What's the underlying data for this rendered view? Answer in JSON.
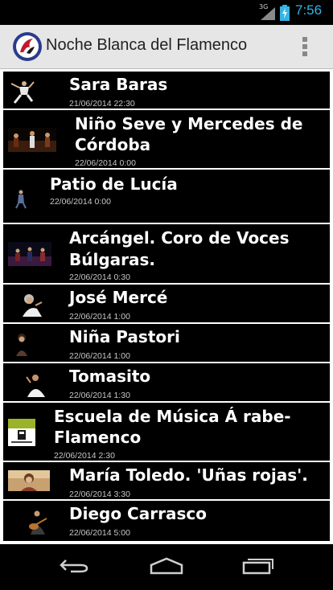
{
  "status_bar": {
    "network": "3G",
    "time": "7:56"
  },
  "action_bar": {
    "title": "Noche Blanca del Flamenco",
    "icon": "app-logo-icon",
    "menu_icon": "overflow-menu-icon"
  },
  "events": [
    {
      "title_lines": [
        "Sara Baras"
      ],
      "date": "21/06/2014 22:30",
      "thumb": "dancer-photo"
    },
    {
      "title_lines": [
        "Niño Seve y Mercedes de",
        "Córdoba"
      ],
      "date": "22/06/2014 0:00",
      "thumb": "group-photo"
    },
    {
      "title_lines": [
        "Patio de Lucía"
      ],
      "date": "22/06/2014 0:00",
      "thumb": "dancer-photo"
    },
    {
      "title_lines": [
        "Arcángel. Coro de Voces",
        "Búlgaras."
      ],
      "date": "22/06/2014 0:30",
      "thumb": "stage-photo"
    },
    {
      "title_lines": [
        "José Mercé"
      ],
      "date": "22/06/2014 1:00",
      "thumb": "singer-photo"
    },
    {
      "title_lines": [
        "Niña Pastori"
      ],
      "date": "22/06/2014 1:00",
      "thumb": "singer-photo"
    },
    {
      "title_lines": [
        "Tomasito"
      ],
      "date": "22/06/2014 1:30",
      "thumb": "singer-photo"
    },
    {
      "title_lines": [
        "Escuela de Música Á rabe-",
        "Flamenco"
      ],
      "date": "22/06/2014 2:30",
      "thumb": "school-logo"
    },
    {
      "title_lines": [
        "María Toledo. 'Uñas rojas'."
      ],
      "date": "22/06/2014 3:30",
      "thumb": "portrait-photo"
    },
    {
      "title_lines": [
        "Diego Carrasco"
      ],
      "date": "22/06/2014 5:00",
      "thumb": "guitarist-photo"
    }
  ],
  "nav_bar": {
    "back": "back-icon",
    "home": "home-icon",
    "recents": "recent-apps-icon"
  }
}
